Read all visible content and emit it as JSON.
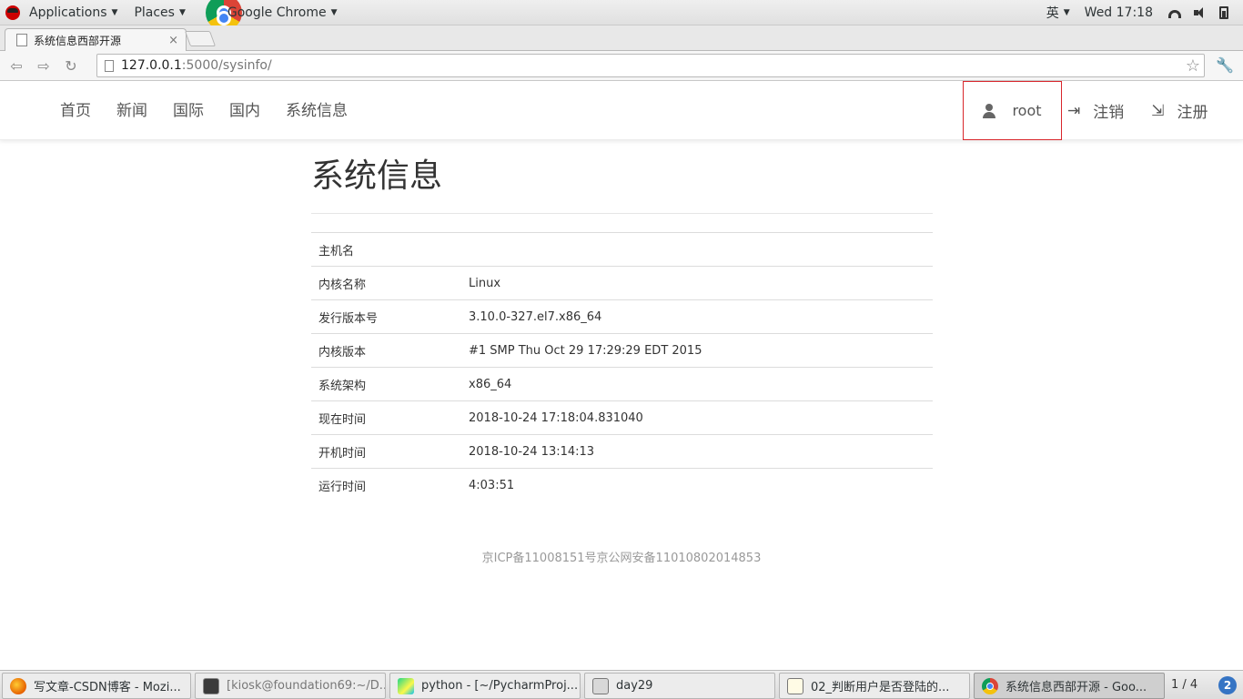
{
  "top_panel": {
    "applications": "Applications",
    "places": "Places",
    "app_name": "Google Chrome",
    "input_method": "英",
    "clock": "Wed 17:18"
  },
  "browser": {
    "tab_title": "系统信息西部开源",
    "tab_close": "×",
    "url_host": "127.0.0.1",
    "url_path": ":5000/sysinfo/"
  },
  "navbar": {
    "links": [
      "首页",
      "新闻",
      "国际",
      "国内",
      "系统信息"
    ],
    "user": "root",
    "logout": "注销",
    "register": "注册"
  },
  "page": {
    "title": "系统信息",
    "rows": [
      {
        "key": "主机名",
        "value": ""
      },
      {
        "key": "内核名称",
        "value": "Linux"
      },
      {
        "key": "发行版本号",
        "value": "3.10.0-327.el7.x86_64"
      },
      {
        "key": "内核版本",
        "value": "#1 SMP Thu Oct 29 17:29:29 EDT 2015"
      },
      {
        "key": "系统架构",
        "value": "x86_64"
      },
      {
        "key": "现在时间",
        "value": "2018-10-24 17:18:04.831040"
      },
      {
        "key": "开机时间",
        "value": "2018-10-24 13:14:13"
      },
      {
        "key": "运行时间",
        "value": "4:03:51"
      }
    ],
    "footer": "京ICP备11008151号京公网安备11010802014853"
  },
  "taskbar": {
    "tasks": [
      "写文章-CSDN博客 - Mozi...",
      "[kiosk@foundation69:~/D...",
      "python - [~/PycharmProj...",
      "day29",
      "02_判断用户是否登陆的...",
      "系统信息西部开源 - Goo..."
    ],
    "workspace": "1 / 4",
    "workspace_badge": "2"
  },
  "colors": {
    "user_box_border": "#d9262b",
    "text": "#333333",
    "footer_text": "#999999"
  }
}
